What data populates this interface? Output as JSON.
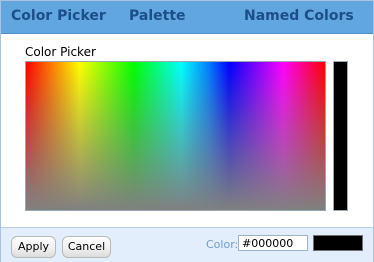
{
  "tabs": {
    "color_picker": "Color Picker",
    "palette": "Palette",
    "named_colors": "Named Colors"
  },
  "content": {
    "title": "Color Picker"
  },
  "footer": {
    "apply_label": "Apply",
    "cancel_label": "Cancel",
    "color_label": "Color:",
    "color_value": "#000000",
    "preview_color": "#000000"
  },
  "colors": {
    "tabbar_bg": "#62a6e0",
    "tab_text": "#1c4e88",
    "footer_bg": "#e2eefb",
    "color_label": "#6d9ccc"
  }
}
